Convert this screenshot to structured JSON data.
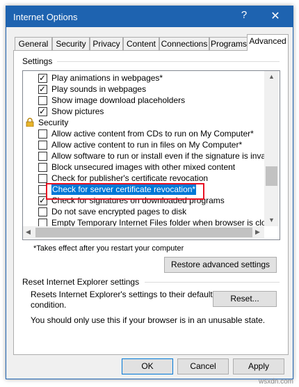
{
  "window": {
    "title": "Internet Options",
    "help_label": "?",
    "close_label": "✕"
  },
  "tabs": [
    "General",
    "Security",
    "Privacy",
    "Content",
    "Connections",
    "Programs",
    "Advanced"
  ],
  "settings": {
    "group_label": "Settings",
    "rows": [
      {
        "label": "Play animations in webpages*",
        "checked": true
      },
      {
        "label": "Play sounds in webpages",
        "checked": true
      },
      {
        "label": "Show image download placeholders",
        "checked": false
      },
      {
        "label": "Show pictures",
        "checked": true
      },
      {
        "label": "Security",
        "checked": null
      },
      {
        "label": "Allow active content from CDs to run on My Computer*",
        "checked": false
      },
      {
        "label": "Allow active content to run in files on My Computer*",
        "checked": false
      },
      {
        "label": "Allow software to run or install even if the signature is inva",
        "checked": false
      },
      {
        "label": "Block unsecured images with other mixed content",
        "checked": false
      },
      {
        "label": "Check for publisher's certificate revocation",
        "checked": false
      },
      {
        "label": "Check for server certificate revocation*",
        "checked": false,
        "highlight": true
      },
      {
        "label": "Check for signatures on downloaded programs",
        "checked": true
      },
      {
        "label": "Do not save encrypted pages to disk",
        "checked": false
      },
      {
        "label": "Empty Temporary Internet Files folder when browser is clo",
        "checked": false
      }
    ],
    "note": "*Takes effect after you restart your computer",
    "restore_label": "Restore advanced settings"
  },
  "reset": {
    "group_label": "Reset Internet Explorer settings",
    "description_1": "Resets Internet Explorer's settings to their default",
    "description_2": "condition.",
    "reset_label": "Reset...",
    "warning": "You should only use this if your browser is in an unusable state."
  },
  "footer": {
    "ok_label": "OK",
    "cancel_label": "Cancel",
    "apply_label": "Apply"
  },
  "watermark": "wsxdn.com",
  "colors": {
    "titlebar": "#1e63b0",
    "highlight": "#0078d7",
    "redbox": "#e81123"
  }
}
